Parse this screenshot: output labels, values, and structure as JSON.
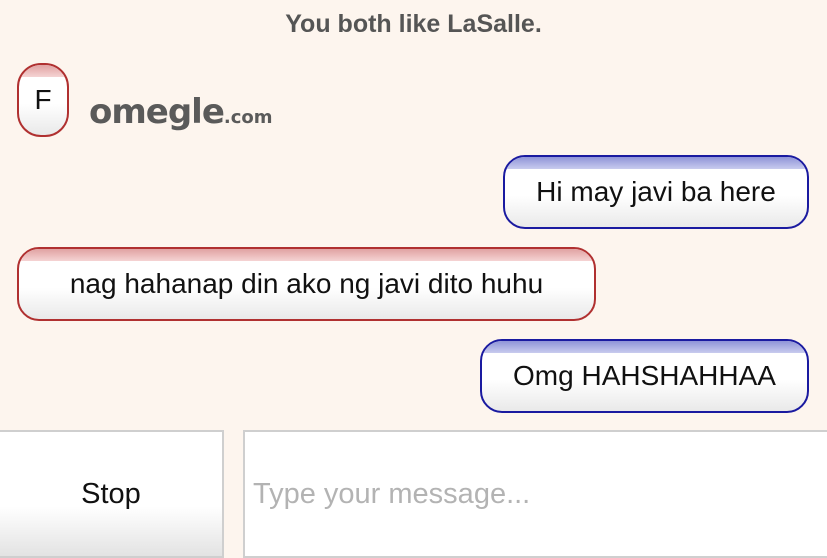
{
  "header": {
    "common_interest": "You both like LaSalle."
  },
  "stranger_avatar": {
    "letter": "F"
  },
  "logo": {
    "main": "omegle",
    "tld": ".com"
  },
  "messages": [
    {
      "from": "you",
      "text": "Hi may javi ba here"
    },
    {
      "from": "stranger",
      "text": "nag hahanap din ako ng javi dito huhu"
    },
    {
      "from": "you",
      "text": "Omg HAHSHAHHAA"
    }
  ],
  "controls": {
    "stop_label": "Stop",
    "message_placeholder": "Type your message..."
  },
  "colors": {
    "background": "#fdf5ee",
    "stranger_border": "#b03030",
    "you_border": "#1a1aa0",
    "placeholder": "#b3b3b3"
  }
}
